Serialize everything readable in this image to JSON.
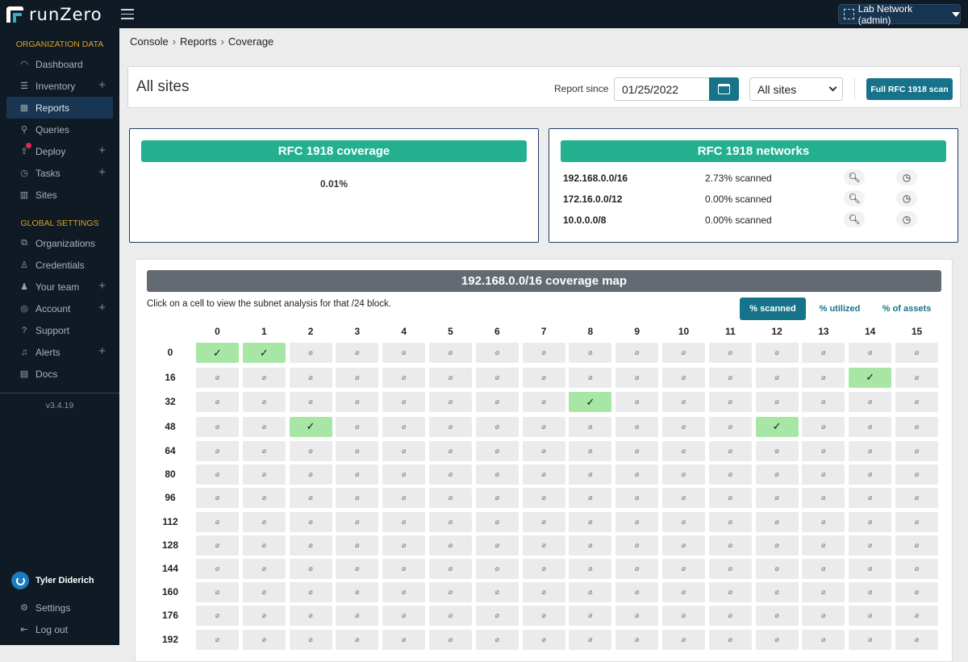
{
  "app": {
    "name": "runZero",
    "org_selector": "Lab Network (admin)"
  },
  "sidebar": {
    "org_section_title": "ORGANIZATION DATA",
    "org_items": [
      {
        "label": "Dashboard",
        "icon": "gauge-icon",
        "glyph": "◠",
        "plus": false
      },
      {
        "label": "Inventory",
        "icon": "server-icon",
        "glyph": "☰",
        "plus": true
      },
      {
        "label": "Reports",
        "icon": "table-icon",
        "glyph": "▦",
        "plus": false,
        "active": true
      },
      {
        "label": "Queries",
        "icon": "search-icon",
        "glyph": "⚲",
        "plus": false
      },
      {
        "label": "Deploy",
        "icon": "deploy-icon",
        "glyph": "⇪",
        "plus": true,
        "badge": true
      },
      {
        "label": "Tasks",
        "icon": "task-clock-icon",
        "glyph": "◷",
        "plus": true
      },
      {
        "label": "Sites",
        "icon": "building-icon",
        "glyph": "▥",
        "plus": false
      }
    ],
    "global_section_title": "GLOBAL SETTINGS",
    "global_items": [
      {
        "label": "Organizations",
        "icon": "organizations-icon",
        "glyph": "⧉",
        "plus": false
      },
      {
        "label": "Credentials",
        "icon": "credentials-icon",
        "glyph": "♙",
        "plus": false
      },
      {
        "label": "Your team",
        "icon": "team-icon",
        "glyph": "♟",
        "plus": true
      },
      {
        "label": "Account",
        "icon": "account-icon",
        "glyph": "◎",
        "plus": true
      },
      {
        "label": "Support",
        "icon": "help-icon",
        "glyph": "?",
        "plus": false
      },
      {
        "label": "Alerts",
        "icon": "bell-icon",
        "glyph": "♫",
        "plus": true
      },
      {
        "label": "Docs",
        "icon": "docs-icon",
        "glyph": "▤",
        "plus": false
      }
    ],
    "version": "v3.4.19",
    "user_name": "Tyler Diderich",
    "bottom_items": [
      {
        "label": "Settings",
        "icon": "gear-icon",
        "glyph": "⚙"
      },
      {
        "label": "Log out",
        "icon": "logout-icon",
        "glyph": "⇤"
      }
    ]
  },
  "breadcrumb": [
    "Console",
    "Reports",
    "Coverage"
  ],
  "header": {
    "title": "All sites",
    "report_since_label": "Report since",
    "report_since_value": "01/25/2022",
    "site_select_value": "All sites",
    "scan_button": "Full RFC 1918 scan"
  },
  "coverage_panel": {
    "title": "RFC 1918 coverage",
    "value": "0.01%"
  },
  "networks_panel": {
    "title": "RFC 1918 networks",
    "rows": [
      {
        "cidr": "192.168.0.0/16",
        "scanned": "2.73% scanned"
      },
      {
        "cidr": "172.16.0.0/12",
        "scanned": "0.00% scanned"
      },
      {
        "cidr": "10.0.0.0/8",
        "scanned": "0.00% scanned"
      }
    ]
  },
  "coverage_map": {
    "title": "192.168.0.0/16 coverage map",
    "hint": "Click on a cell to view the subnet analysis for that /24 block.",
    "toggles": [
      {
        "label": "% scanned",
        "active": true
      },
      {
        "label": "% utilized",
        "active": false
      },
      {
        "label": "% of assets",
        "active": false
      }
    ],
    "columns": [
      "0",
      "1",
      "2",
      "3",
      "4",
      "5",
      "6",
      "7",
      "8",
      "9",
      "10",
      "11",
      "12",
      "13",
      "14",
      "15"
    ],
    "rows": [
      "0",
      "16",
      "32",
      "48",
      "64",
      "80",
      "96",
      "112",
      "128",
      "144",
      "160",
      "176",
      "192"
    ],
    "scanned_symbol": "✓",
    "unscanned_symbol": "⌀",
    "scanned_cells": [
      [
        0,
        0
      ],
      [
        0,
        1
      ],
      [
        1,
        14
      ],
      [
        2,
        8
      ],
      [
        3,
        2
      ],
      [
        3,
        12
      ]
    ]
  }
}
